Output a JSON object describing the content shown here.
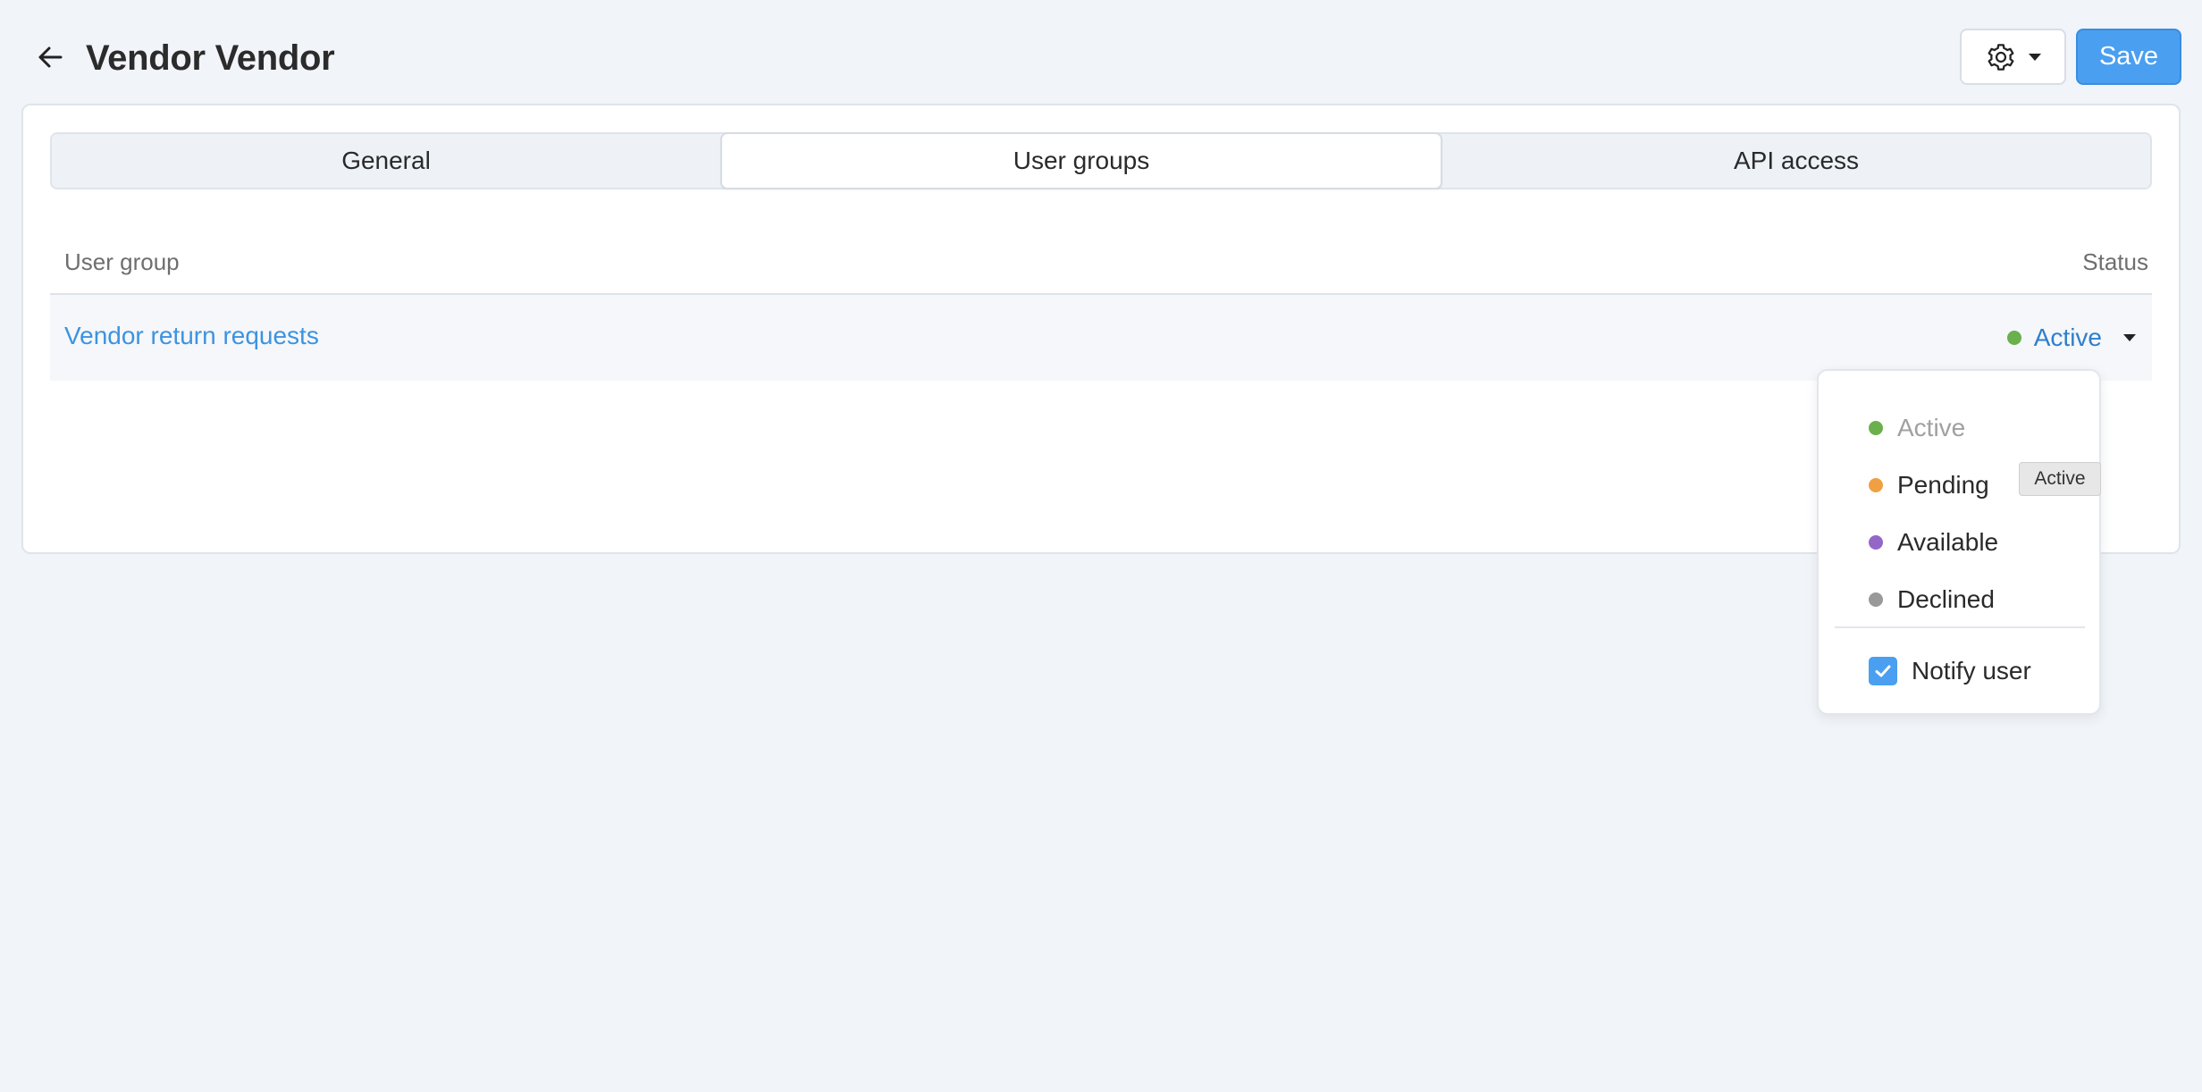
{
  "header": {
    "title": "Vendor Vendor",
    "back_icon": "arrow-left-icon",
    "settings_icon": "gear-icon",
    "save_label": "Save"
  },
  "tabs": [
    {
      "label": "General",
      "active": false
    },
    {
      "label": "User groups",
      "active": true
    },
    {
      "label": "API access",
      "active": false
    }
  ],
  "table": {
    "columns": [
      "User group",
      "Status"
    ],
    "rows": [
      {
        "user_group": "Vendor return requests",
        "status": "Active"
      }
    ]
  },
  "status_menu": {
    "options": [
      {
        "label": "Active",
        "color": "#6ab04c",
        "disabled": true
      },
      {
        "label": "Pending",
        "color": "#f0a040",
        "disabled": false
      },
      {
        "label": "Available",
        "color": "#9466c8",
        "disabled": false
      },
      {
        "label": "Declined",
        "color": "#999999",
        "disabled": false
      }
    ],
    "notify_label": "Notify user",
    "notify_checked": true
  },
  "tooltip": "Active",
  "colors": {
    "accent": "#4a9ff0",
    "link": "#3d93e0",
    "status_active": "#6ab04c"
  }
}
